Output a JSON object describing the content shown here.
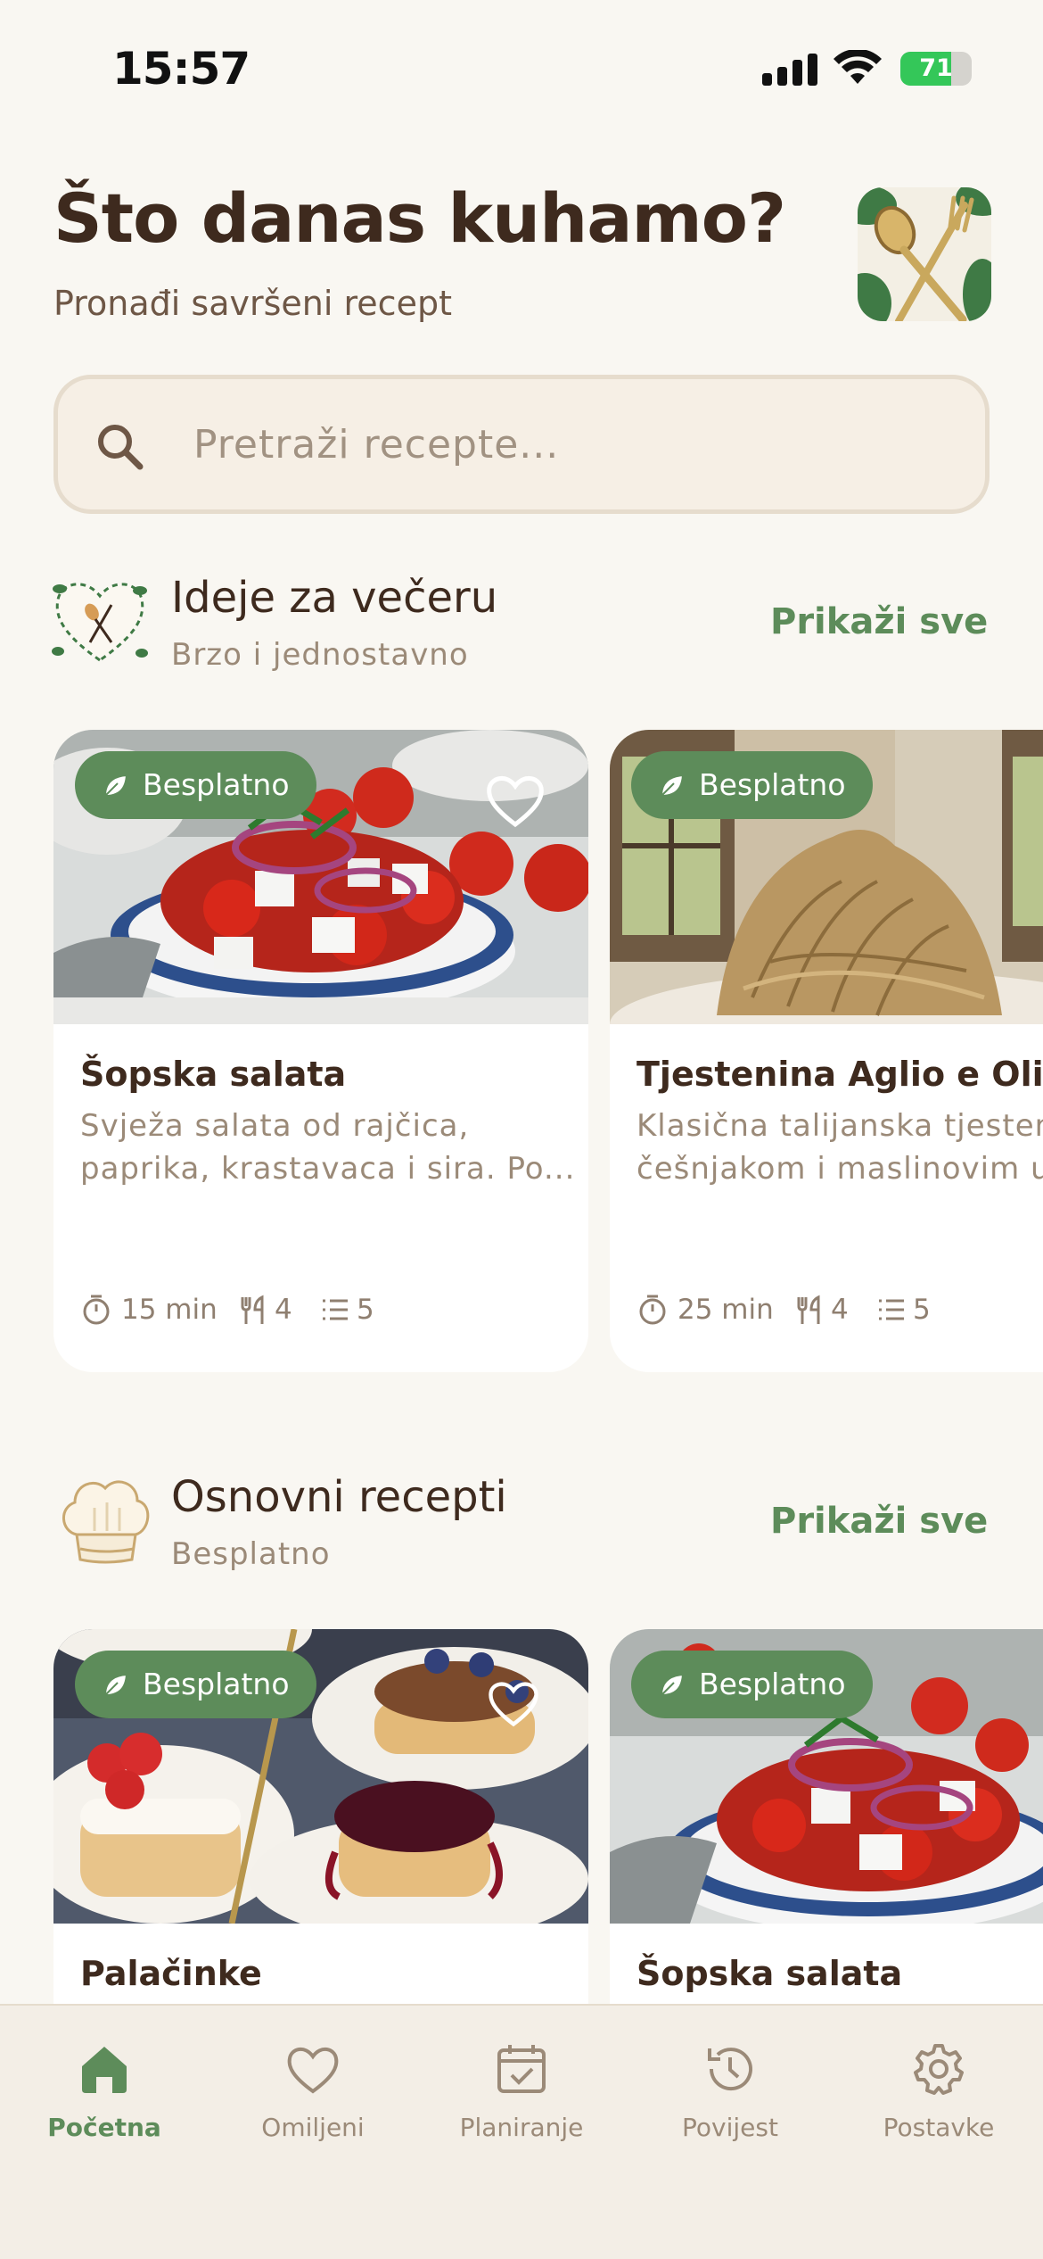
{
  "status_bar": {
    "time": "15:57",
    "battery": "71",
    "battery_level": 0.71
  },
  "header": {
    "title": "Što danas kuhamo?",
    "subtitle": "Pronađi savršeni recept",
    "logo_icon": "spoon-fork-icon"
  },
  "search": {
    "placeholder": "Pretraži recepte...",
    "value": ""
  },
  "sections": [
    {
      "title": "Ideje za večeru",
      "subtitle": "Brzo i jednostavno",
      "show_all": "Prikaži sve",
      "icon": "heart-cutlery-icon",
      "cards": [
        {
          "badge": "Besplatno",
          "title": "Šopska salata",
          "desc_line1": "Svježa salata od rajčica,",
          "desc_line2": "paprika, krastavaca i sira. Po...",
          "time": "15 min",
          "servings": "4",
          "steps": "5",
          "favorite": true
        },
        {
          "badge": "Besplatno",
          "title": "Tjestenina Aglio e Olio",
          "desc_line1": "Klasična talijanska tjestenina s",
          "desc_line2": "češnjakom i maslinovim uljem...",
          "time": "25 min",
          "servings": "4",
          "steps": "5",
          "favorite": false
        }
      ]
    },
    {
      "title": "Osnovni recepti",
      "subtitle": "Besplatno",
      "show_all": "Prikaži sve",
      "icon": "chef-hat-icon",
      "cards": [
        {
          "badge": "Besplatno",
          "title": "Palačinke",
          "favorite": true
        },
        {
          "badge": "Besplatno",
          "title": "Šopska salata",
          "favorite": false
        }
      ]
    }
  ],
  "tabs": [
    {
      "label": "Početna",
      "icon": "home-icon",
      "active": true
    },
    {
      "label": "Omiljeni",
      "icon": "heart-icon",
      "active": false
    },
    {
      "label": "Planiranje",
      "icon": "calendar-check-icon",
      "active": false
    },
    {
      "label": "Povijest",
      "icon": "history-icon",
      "active": false
    },
    {
      "label": "Postavke",
      "icon": "settings-icon",
      "active": false
    }
  ],
  "colors": {
    "accent": "#5d8c5a",
    "text": "#3e2a1e",
    "muted": "#9b8a78",
    "background": "#f9f7f2",
    "card": "#ffffff"
  }
}
